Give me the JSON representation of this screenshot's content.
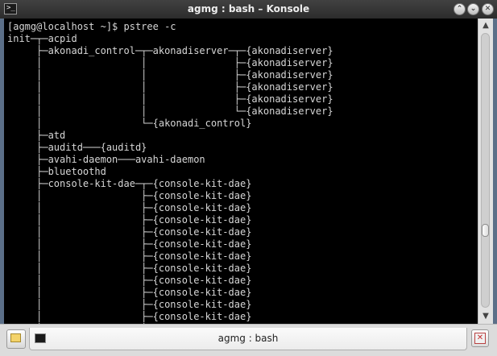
{
  "window": {
    "title": "agmg : bash – Konsole",
    "icons": {
      "app": "terminal-icon",
      "minimize": "minimize-icon",
      "maximize": "maximize-icon",
      "close": "close-icon"
    }
  },
  "terminal": {
    "background": "#000000",
    "foreground": "#d6d6d6",
    "lines": [
      "[agmg@localhost ~]$ pstree -c",
      "init─┬─acpid",
      "     ├─akonadi_control─┬─akonadiserver─┬─{akonadiserver}",
      "     │                 │               ├─{akonadiserver}",
      "     │                 │               ├─{akonadiserver}",
      "     │                 │               ├─{akonadiserver}",
      "     │                 │               ├─{akonadiserver}",
      "     │                 │               └─{akonadiserver}",
      "     │                 └─{akonadi_control}",
      "     ├─atd",
      "     ├─auditd───{auditd}",
      "     ├─avahi-daemon───avahi-daemon",
      "     ├─bluetoothd",
      "     ├─console-kit-dae─┬─{console-kit-dae}",
      "     │                 ├─{console-kit-dae}",
      "     │                 ├─{console-kit-dae}",
      "     │                 ├─{console-kit-dae}",
      "     │                 ├─{console-kit-dae}",
      "     │                 ├─{console-kit-dae}",
      "     │                 ├─{console-kit-dae}",
      "     │                 ├─{console-kit-dae}",
      "     │                 ├─{console-kit-dae}",
      "     │                 ├─{console-kit-dae}",
      "     │                 ├─{console-kit-dae}",
      "     │                 ├─{console-kit-dae}",
      "     │                 ├─{console-kit-dae}"
    ]
  },
  "scrollbar": {
    "position": 0.73,
    "icons": {
      "up": "arrow-up-icon",
      "down": "arrow-down-icon"
    }
  },
  "tabbar": {
    "tabs": [
      {
        "label": "agmg : bash",
        "icon": "terminal-icon"
      }
    ],
    "icons": {
      "new_tab": "new-tab-icon",
      "close_tab": "close-tab-icon"
    }
  }
}
